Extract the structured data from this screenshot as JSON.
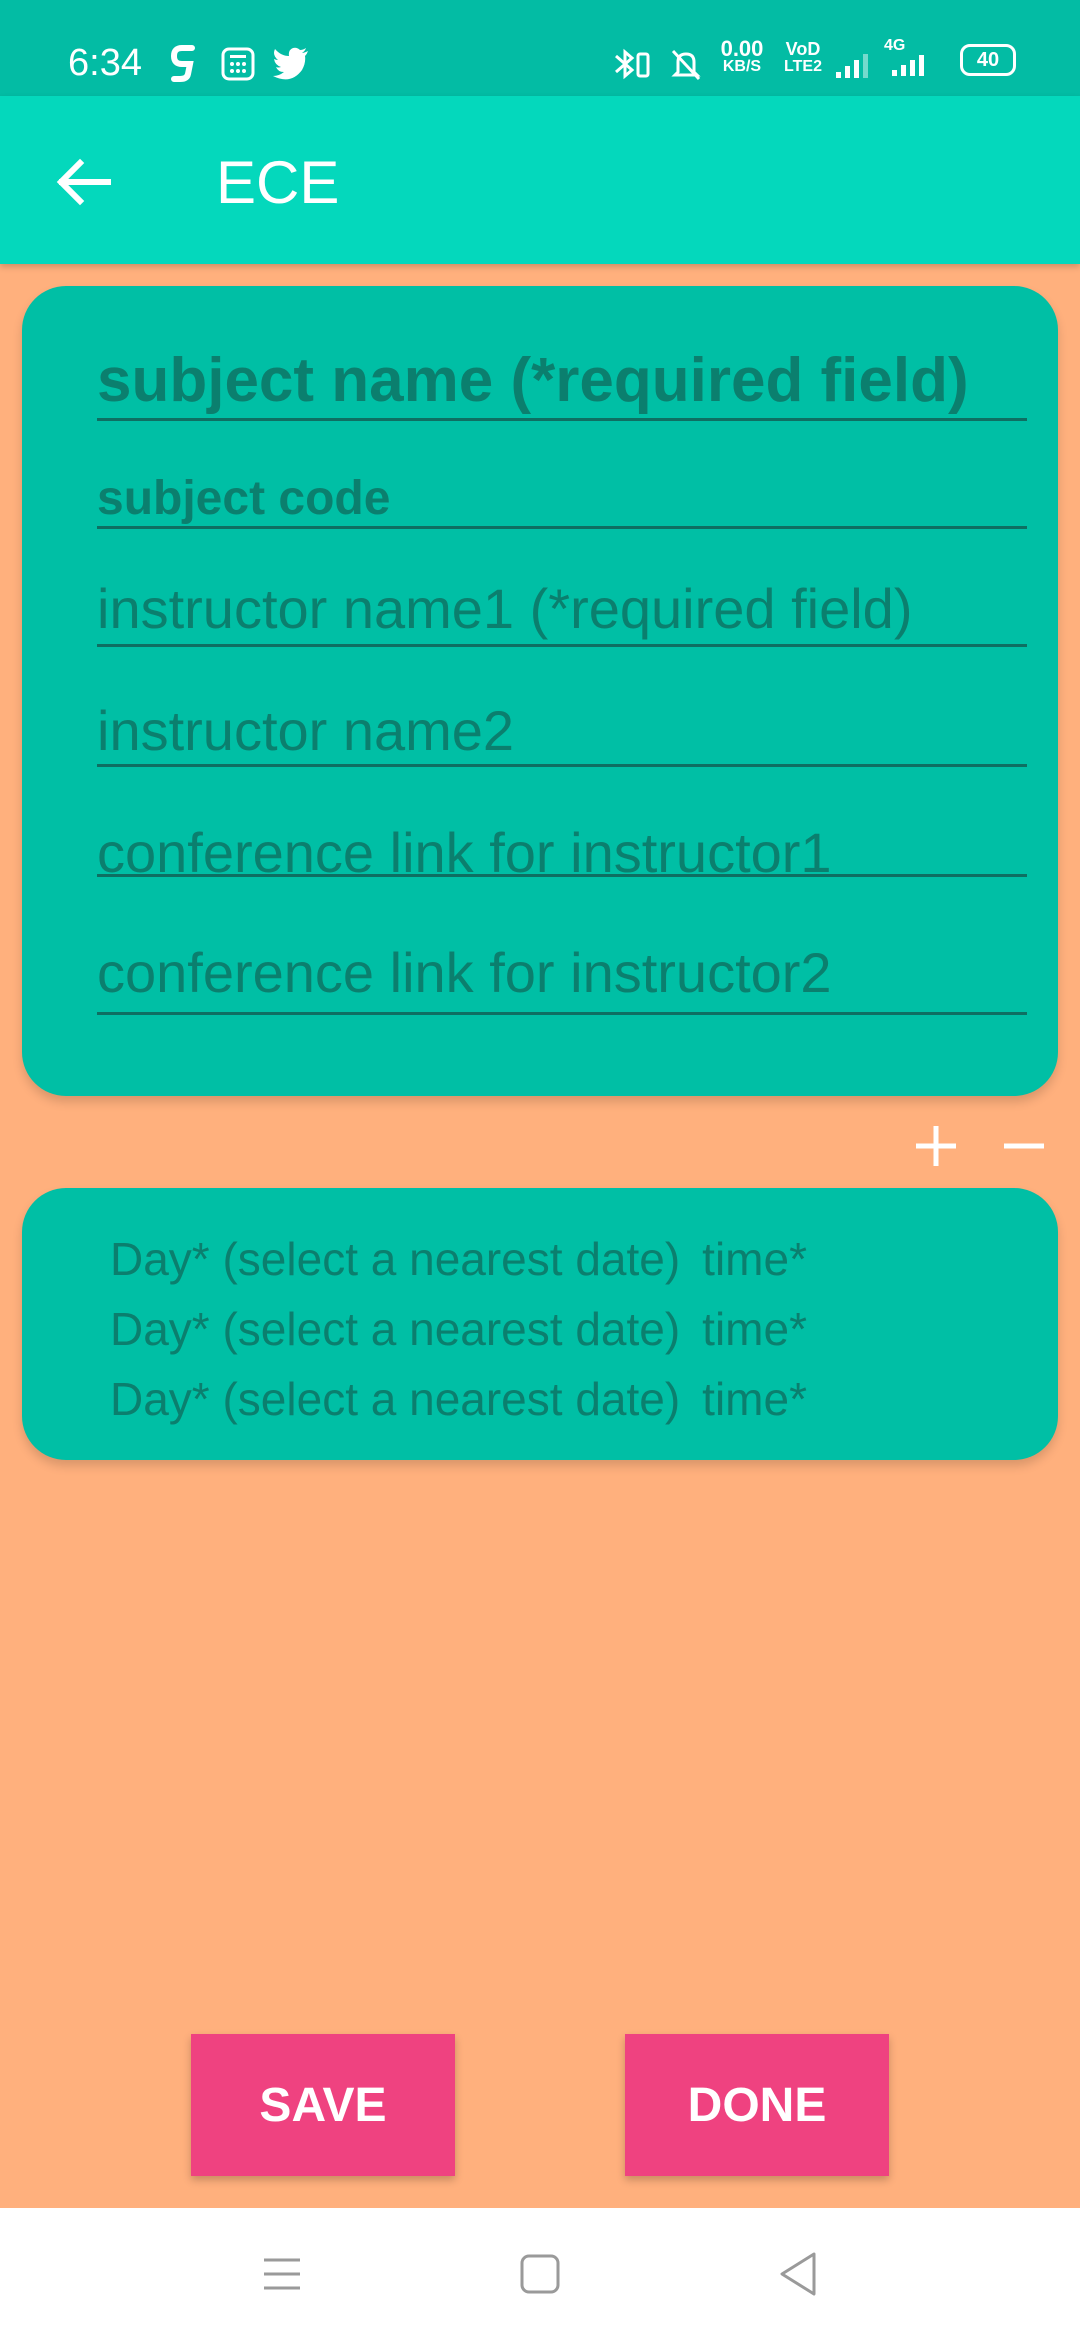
{
  "status_bar": {
    "time": "6:34",
    "left_icons": [
      "g-app-icon",
      "calculator-app-icon",
      "twitter-icon"
    ],
    "right_icons": [
      "bluetooth-icon",
      "mute-bell-icon",
      "network-speed-text",
      "volte-icon",
      "signal-icon",
      "4g-signal-icon",
      "battery-icon"
    ],
    "network_speed_value": "0.00",
    "network_speed_unit": "KB/S",
    "volte_top": "VoD",
    "volte_bottom": "LTE2",
    "network_type": "4G",
    "battery_level": "40"
  },
  "app_bar": {
    "back_icon": "arrow-left-icon",
    "title": "ECE"
  },
  "subject_form": {
    "subject_name_placeholder": "subject name (*required field)",
    "subject_code_placeholder": "subject code",
    "instructor1_placeholder": "instructor name1 (*required field)",
    "instructor2_placeholder": "instructor name2",
    "conference1_placeholder": "conference link for instructor1",
    "conference2_placeholder": "conference link for instructor2"
  },
  "schedule_controls": {
    "add_icon": "plus-icon",
    "remove_icon": "minus-icon"
  },
  "schedule": {
    "rows": [
      {
        "day": "Day* (select a nearest date)",
        "time": "time*"
      },
      {
        "day": "Day* (select a nearest date)",
        "time": "time*"
      },
      {
        "day": "Day* (select a nearest date)",
        "time": "time*"
      }
    ]
  },
  "actions": {
    "save_label": "SAVE",
    "done_label": "DONE"
  },
  "nav_bar": {
    "menu_icon": "menu-icon",
    "home_icon": "square-home-icon",
    "back_icon": "triangle-back-icon"
  },
  "colors": {
    "background": "#FFB07D",
    "status_bar": "#03BCA4",
    "app_bar": "#04D8BC",
    "card": "#00BFA5",
    "card_text": "#0B7F6E",
    "button": "#EF4280"
  }
}
